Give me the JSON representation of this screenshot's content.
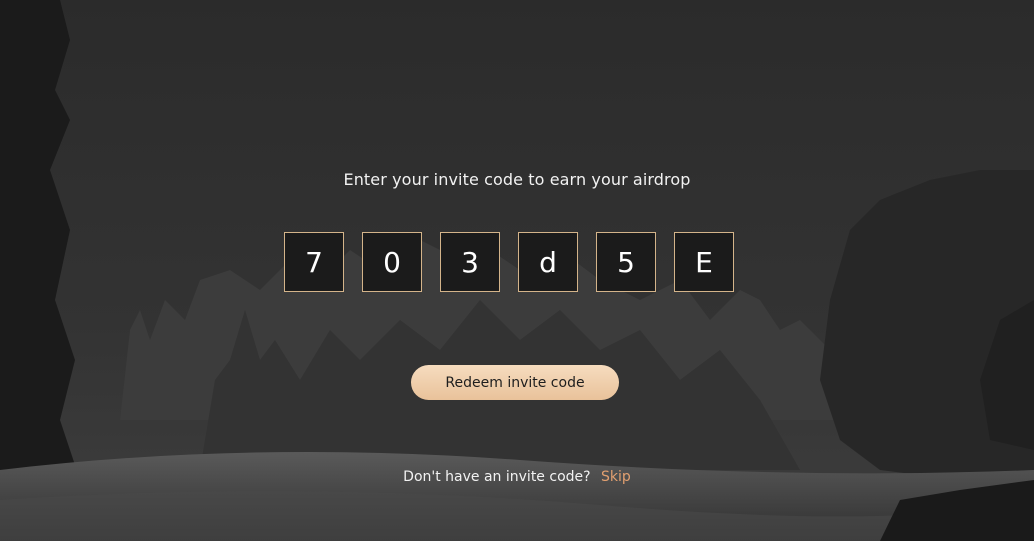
{
  "prompt": {
    "title": "Enter your invite code to earn your airdrop"
  },
  "code": {
    "digits": [
      "7",
      "0",
      "3",
      "d",
      "5",
      "E"
    ]
  },
  "actions": {
    "redeem_label": "Redeem invite code",
    "no_code_text": "Don't have an invite code?",
    "skip_label": "Skip"
  },
  "colors": {
    "accent": "#e9c29a",
    "skip_link": "#e2a070",
    "box_border": "#d4b48a"
  }
}
